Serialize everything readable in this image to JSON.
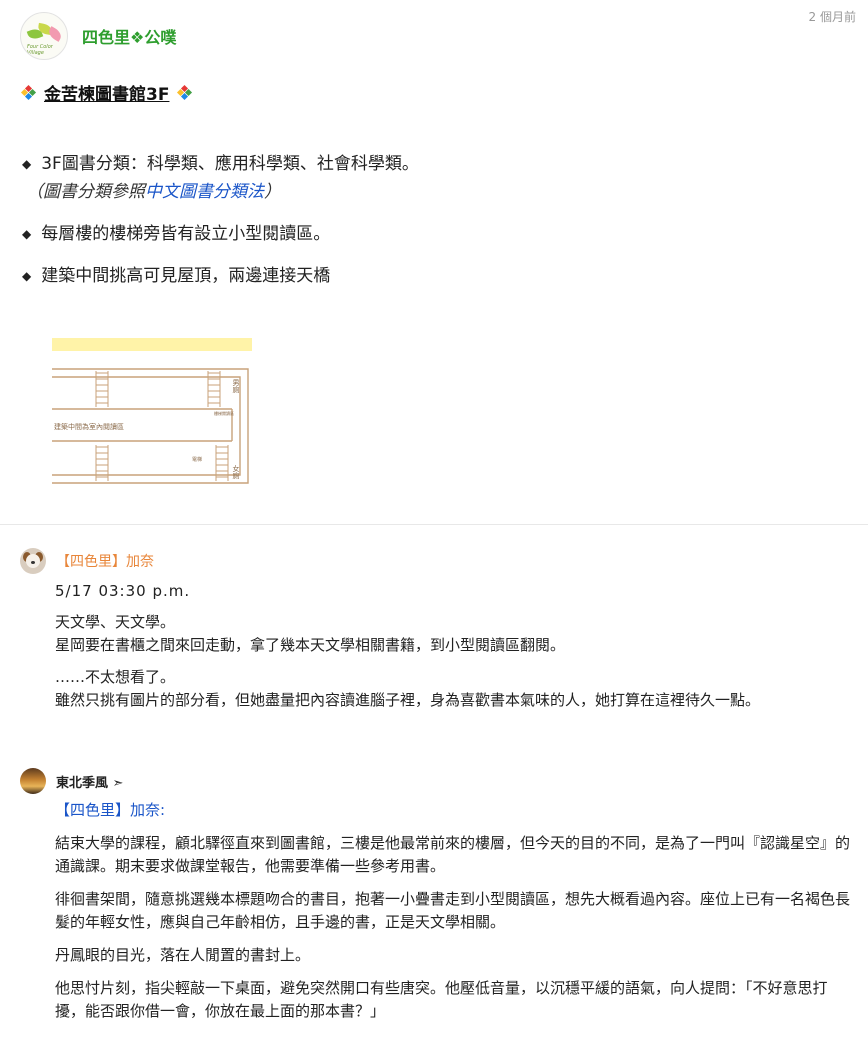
{
  "post": {
    "timestamp": "2 個月前",
    "author": "四色里❖公噗",
    "title": "金苦楝圖書館3F",
    "bullets": [
      "3F圖書分類：科學類、應用科學類、社會科學類。",
      "每層樓的樓梯旁皆有設立小型閱讀區。",
      "建築中間挑高可見屋頂，兩邊連接天橋"
    ],
    "bullet_icon": "◆",
    "note_open": "（圖書分類參照",
    "note_link": "中文圖書分類法",
    "note_close": "）",
    "map": {
      "label_male": "男廁",
      "label_female": "女廁",
      "label_center": "建築中間為室內閱讀區",
      "label_small1": "樓梯閱讀區",
      "label_small2": "電梯"
    }
  },
  "comments": [
    {
      "name": "【四色里】加奈",
      "date": "5/17 03:30 p.m.",
      "paragraphs": [
        [
          "天文學、天文學。",
          "星岡要在書櫃之間來回走動，拿了幾本天文學相關書籍，到小型閱讀區翻閱。"
        ],
        [
          "……不太想看了。",
          "雖然只挑有圖片的部分看，但她盡量把內容讀進腦子裡，身為喜歡書本氣味的人，她打算在這裡待久一點。"
        ]
      ]
    },
    {
      "name": "東北季風 ➣",
      "reply_to": "【四色里】加奈:",
      "paragraphs": [
        "結束大學的課程，顧北驛徑直來到圖書館，三樓是他最常前來的樓層，但今天的目的不同，是為了一門叫『認識星空』的通識課。期末要求做課堂報告，他需要準備一些參考用書。",
        "徘徊書架間，隨意挑選幾本標題吻合的書目，抱著一小疊書走到小型閱讀區，想先大概看過內容。座位上已有一名褐色長髮的年輕女性，應與自己年齡相仿，且手邊的書，正是天文學相關。",
        "丹鳳眼的目光，落在人閒置的書封上。",
        "他思忖片刻，指尖輕敲一下桌面，避免突然開口有些唐突。他壓低音量，以沉穩平緩的語氣，向人提問：「不好意思打擾，能否跟你借一會，你放在最上面的那本書？」"
      ]
    }
  ],
  "colors": {
    "author": "#2e9e2e",
    "commenter1": "#e8863a",
    "link": "#1a55c8",
    "map_line": "#c8a27a",
    "map_highlight": "#fff3a8"
  }
}
